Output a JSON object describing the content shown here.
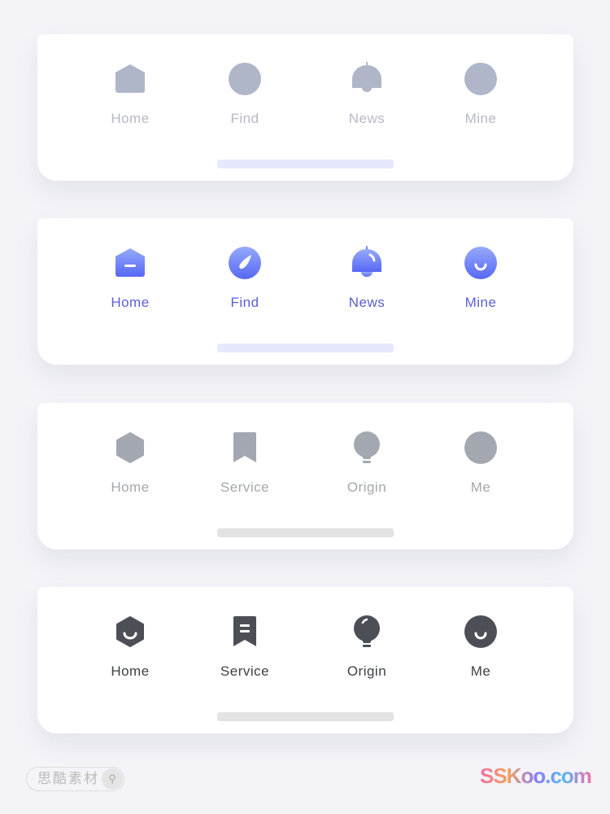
{
  "tabbars": [
    {
      "style": "inactive-light",
      "label_color": "#b4b9c6",
      "icon_color": "#afb6c8",
      "indicator_color": "#e6e9fd",
      "items": [
        {
          "label": "Home",
          "icon": "home-icon"
        },
        {
          "label": "Find",
          "icon": "find-icon"
        },
        {
          "label": "News",
          "icon": "bell-icon"
        },
        {
          "label": "Mine",
          "icon": "user-icon"
        }
      ]
    },
    {
      "style": "active-gradient",
      "label_color": "#5a5fd6",
      "icon_gradient": [
        "#96aaf9",
        "#5767f6"
      ],
      "indicator_color": "#e6e9fd",
      "items": [
        {
          "label": "Home",
          "icon": "home-icon"
        },
        {
          "label": "Find",
          "icon": "compass-icon"
        },
        {
          "label": "News",
          "icon": "bell-icon"
        },
        {
          "label": "Mine",
          "icon": "smile-icon"
        }
      ]
    },
    {
      "style": "inactive-gray",
      "label_color": "#a4a7ad",
      "icon_color": "#a3a7b0",
      "indicator_color": "#e3e3e3",
      "items": [
        {
          "label": "Home",
          "icon": "hexagon-icon"
        },
        {
          "label": "Service",
          "icon": "bookmark-icon"
        },
        {
          "label": "Origin",
          "icon": "bulb-icon"
        },
        {
          "label": "Me",
          "icon": "user-icon"
        }
      ]
    },
    {
      "style": "active-dark",
      "label_color": "#3e4045",
      "icon_color": "#4c4f56",
      "indicator_color": "#e3e3e3",
      "items": [
        {
          "label": "Home",
          "icon": "hexagon-smile-icon"
        },
        {
          "label": "Service",
          "icon": "bookmark-lines-icon"
        },
        {
          "label": "Origin",
          "icon": "bulb-icon"
        },
        {
          "label": "Me",
          "icon": "smile-icon"
        }
      ]
    }
  ],
  "watermark": {
    "left_text": "思酷素材",
    "right_text": "SSKoo.com"
  }
}
